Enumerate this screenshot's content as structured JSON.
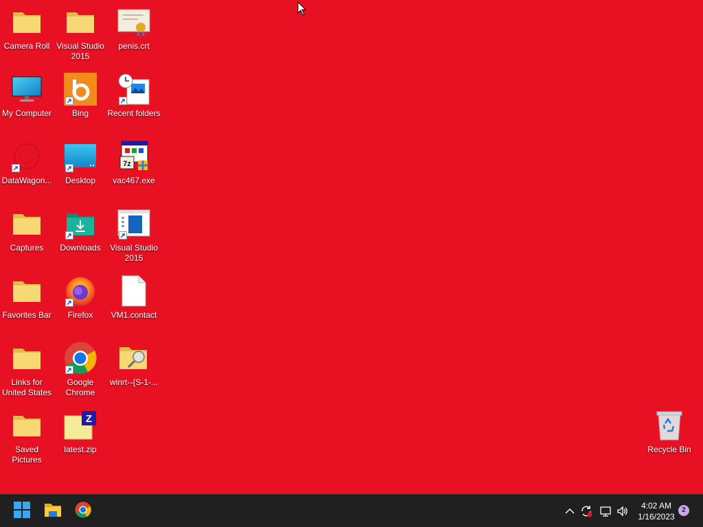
{
  "desktop": {
    "icons": [
      {
        "label": "Camera Roll",
        "type": "folder"
      },
      {
        "label": "Visual Studio 2015",
        "type": "folder"
      },
      {
        "label": "penis.crt",
        "type": "certificate"
      },
      {
        "label": "My Computer",
        "type": "monitor"
      },
      {
        "label": "Bing",
        "type": "bing"
      },
      {
        "label": "Recent folders",
        "type": "recent"
      },
      {
        "label": "DataWagon...",
        "type": "datawagon"
      },
      {
        "label": "Desktop",
        "type": "desktop"
      },
      {
        "label": "vac467.exe",
        "type": "exe"
      },
      {
        "label": "Captures",
        "type": "folder"
      },
      {
        "label": "Downloads",
        "type": "downloads"
      },
      {
        "label": "Visual Studio 2015",
        "type": "vs"
      },
      {
        "label": "Favorites Bar",
        "type": "folder"
      },
      {
        "label": "Firefox",
        "type": "firefox"
      },
      {
        "label": "VM1.contact",
        "type": "file"
      },
      {
        "label": "Links for United States",
        "type": "folder"
      },
      {
        "label": "Google Chrome",
        "type": "chrome"
      },
      {
        "label": "winrt--{S-1-...",
        "type": "search-folder"
      },
      {
        "label": "Saved Pictures",
        "type": "folder"
      },
      {
        "label": "latest.zip",
        "type": "zip"
      },
      {
        "label": "Recycle Bin",
        "type": "recycle"
      }
    ]
  },
  "taskbar": {
    "apps": [
      "start-icon",
      "file-explorer-icon",
      "chrome-icon"
    ],
    "tray": {
      "icons": [
        "chevron-up-icon",
        "sync-icon",
        "network-icon",
        "volume-icon"
      ],
      "time": "4:02 AM",
      "date": "1/16/2023",
      "notification_count": "2"
    }
  },
  "colors": {
    "wallpaper": "#e81123",
    "taskbar": "#202020",
    "folder": "#f8d775"
  }
}
